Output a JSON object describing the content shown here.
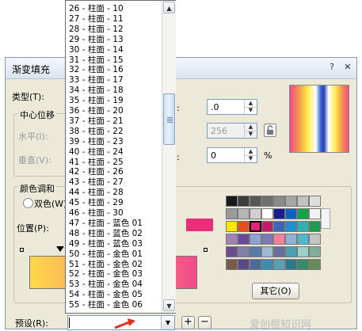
{
  "dialog": {
    "title": "渐变填充",
    "close_glyph": "✕",
    "help_glyph": "?",
    "type_label": "类型(T):",
    "center_offset_group": "中心位移",
    "horizontal_label": "水平(I):",
    "vertical_label": "垂直(V):",
    "angle_value": ".0",
    "steps_value": "256",
    "edge_value": "0",
    "percent_sign": "%",
    "colors_group": "颜色调和",
    "two_color_label": "双色(W)",
    "position_label": "位置(P):",
    "other_button": "其它(O)",
    "preset_label": "预设(R):",
    "preset_value": "",
    "add_preset": "+",
    "remove_preset": "−",
    "watermark": "爱创根知识网"
  },
  "preset_list": {
    "items": [
      "26 - 柱面 - 10",
      "27 - 柱面 - 11",
      "28 - 柱面 - 12",
      "29 - 柱面 - 13",
      "30 - 柱面 - 14",
      "31 - 柱面 - 15",
      "32 - 柱面 - 16",
      "33 - 柱面 - 17",
      "34 - 柱面 - 18",
      "35 - 柱面 - 19",
      "36 - 柱面 - 20",
      "37 - 柱面 - 21",
      "38 - 柱面 - 22",
      "39 - 柱面 - 23",
      "40 - 柱面 - 24",
      "41 - 柱面 - 25",
      "42 - 柱面 - 26",
      "43 - 柱面 - 27",
      "44 - 柱面 - 28",
      "45 - 柱面 - 29",
      "46 - 柱面 - 30",
      "47 - 柱面 - 蓝色 01",
      "48 - 柱面 - 蓝色 02",
      "49 - 柱面 - 蓝色 03",
      "50 - 柱面 - 金色 01",
      "51 - 柱面 - 金色 02",
      "52 - 柱面 - 金色 03",
      "53 - 柱面 - 金色 04",
      "54 - 柱面 - 金色 05",
      "55 - 柱面 - 金色 06"
    ]
  },
  "palette": {
    "colors": [
      "#1a1a1a",
      "#3b3b3b",
      "#575757",
      "#707070",
      "#8a8a8a",
      "#a6a6a6",
      "#c2c2c2",
      "#dedede",
      "#9a9a9a",
      "#b5b5b5",
      "#d0d0d0",
      "#ffffff",
      "#1c1c8c",
      "#0a62c6",
      "#12a24a",
      "#f2f2f2",
      "#ffe400",
      "#e94e1b",
      "#e8207a",
      "#c21c6a",
      "#3f63b6",
      "#1f8fd0",
      "#2fb3b0",
      "#1e9c52",
      "#a57fb8",
      "#6a4a9c",
      "#8fa2d4",
      "#7a7ab5",
      "#ff7e9c",
      "#8fb0d8",
      "#4fb8d0",
      "#c4c4c4",
      "#6b4c8c",
      "#8080a8",
      "#5a7aa8",
      "#9bbad0",
      "#6c6c9c",
      "#49a0b8",
      "#9ad0c8",
      "#7faf9a",
      "#7a5a4a",
      "#5a4a8a",
      "#4a6a9a",
      "#3c8cb0",
      "#5aa0b0",
      "#2a7a8a",
      "#3a8a6a",
      "#6a8a5a"
    ],
    "selected_index": 18,
    "accent_color": "#e8207a"
  }
}
